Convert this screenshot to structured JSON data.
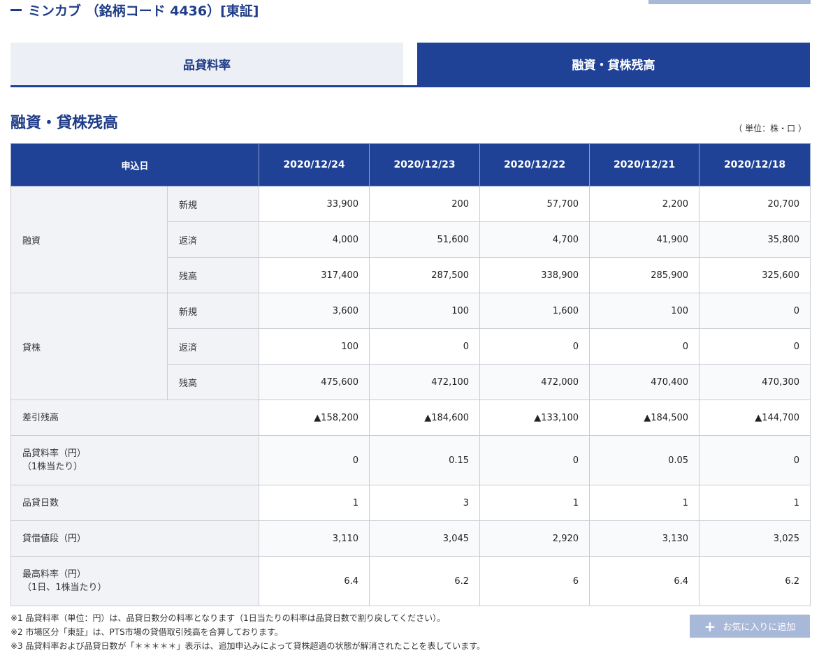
{
  "page": {
    "title": "ミンカブ （銘柄コード 4436）[東証]"
  },
  "tabs": [
    {
      "label": "品貸料率",
      "active": false
    },
    {
      "label": "融資・貸株残高",
      "active": true
    }
  ],
  "section": {
    "title": "融資・貸株残高",
    "unit": "（ 単位：株・口 ）"
  },
  "table": {
    "header_label": "申込日",
    "dates": [
      "2020/12/24",
      "2020/12/23",
      "2020/12/22",
      "2020/12/21",
      "2020/12/18"
    ],
    "groups": [
      {
        "label": "融資",
        "rows": [
          {
            "label": "新規",
            "values": [
              "33,900",
              "200",
              "57,700",
              "2,200",
              "20,700"
            ]
          },
          {
            "label": "返済",
            "values": [
              "4,000",
              "51,600",
              "4,700",
              "41,900",
              "35,800"
            ]
          },
          {
            "label": "残高",
            "values": [
              "317,400",
              "287,500",
              "338,900",
              "285,900",
              "325,600"
            ]
          }
        ]
      },
      {
        "label": "貸株",
        "rows": [
          {
            "label": "新規",
            "values": [
              "3,600",
              "100",
              "1,600",
              "100",
              "0"
            ]
          },
          {
            "label": "返済",
            "values": [
              "100",
              "0",
              "0",
              "0",
              "0"
            ]
          },
          {
            "label": "残高",
            "values": [
              "475,600",
              "472,100",
              "472,000",
              "470,400",
              "470,300"
            ]
          }
        ]
      }
    ],
    "rows": [
      {
        "label": [
          "差引残高"
        ],
        "values": [
          "▲158,200",
          "▲184,600",
          "▲133,100",
          "▲184,500",
          "▲144,700"
        ]
      },
      {
        "label": [
          "品貸料率（円）",
          "（1株当たり）"
        ],
        "values": [
          "0",
          "0.15",
          "0",
          "0.05",
          "0"
        ]
      },
      {
        "label": [
          "品貸日数"
        ],
        "values": [
          "1",
          "3",
          "1",
          "1",
          "1"
        ]
      },
      {
        "label": [
          "貸借値段（円）"
        ],
        "values": [
          "3,110",
          "3,045",
          "2,920",
          "3,130",
          "3,025"
        ]
      },
      {
        "label": [
          "最高料率（円）",
          "（1日、1株当たり）"
        ],
        "values": [
          "6.4",
          "6.2",
          "6",
          "6.4",
          "6.2"
        ]
      }
    ]
  },
  "notes": [
    "※1 品貸料率（単位：円）は、品貸日数分の料率となります（1日当たりの料率は品貸日数で割り戻してください）。",
    "※2 市場区分「東証」は、PTS市場の貸借取引残高を合算しております。",
    "※3 品貸料率および品貸日数が「＊＊＊＊＊」表示は、追加申込みによって貸株超過の状態が解消されたことを表しています。"
  ],
  "favorite_button": {
    "label": "お気に入りに追加",
    "icon": "plus-icon"
  },
  "colors": {
    "primary": "#1f4296",
    "title": "#1f3c88",
    "inactive_tab": "#eceff5",
    "button": "#a8b8d8"
  }
}
